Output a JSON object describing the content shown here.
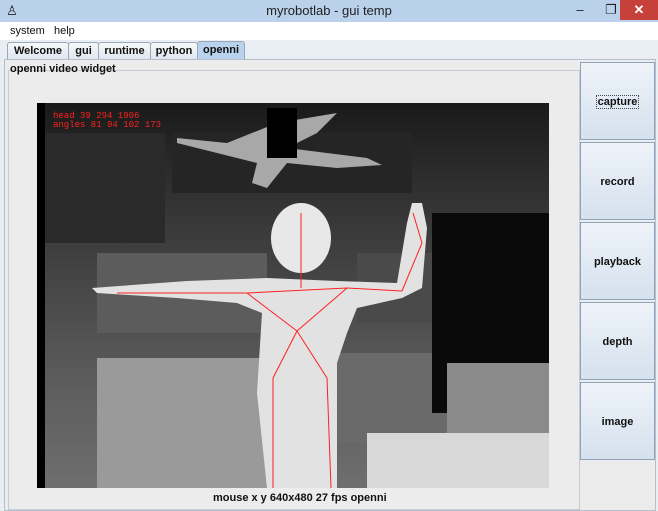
{
  "window": {
    "title": "myrobotlab - gui temp",
    "minimize": "–",
    "maximize": "❐",
    "close": "✕",
    "app_icon": "robot-icon"
  },
  "menu": [
    "system",
    "help"
  ],
  "tabs": [
    "Welcome",
    "gui",
    "runtime",
    "python",
    "openni"
  ],
  "active_tab": "openni",
  "panel": {
    "title": "openni  video widget",
    "overlay_line1": "head 39 294 1906",
    "overlay_line2": "angles 81 94 102 173",
    "status": "mouse x y  640x480  27 fps  openni"
  },
  "buttons": [
    "capture",
    "record",
    "playback",
    "depth",
    "image"
  ],
  "colors": {
    "titlebar": "#b9d1ea",
    "close": "#c7413b",
    "skeleton": "#ff2020"
  }
}
